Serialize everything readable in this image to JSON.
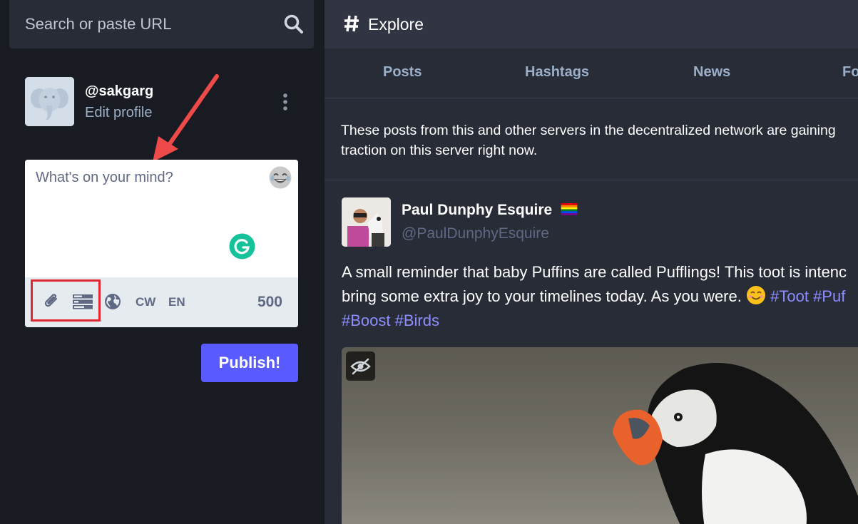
{
  "search": {
    "placeholder": "Search or paste URL",
    "icon": "search-icon"
  },
  "account": {
    "handle": "@sakgarg",
    "edit_label": "Edit profile"
  },
  "compose": {
    "placeholder": "What's on your mind?",
    "cw_label": "CW",
    "language_label": "EN",
    "char_count": "500",
    "publish_label": "Publish!"
  },
  "column": {
    "title": "Explore",
    "tabs": [
      {
        "label": "Posts"
      },
      {
        "label": "Hashtags"
      },
      {
        "label": "News"
      },
      {
        "label": "Fo"
      }
    ],
    "description": "These posts from this and other servers in the decentralized network are gaining traction on this server right now."
  },
  "status": {
    "display_name": "Paul Dunphy Esquire",
    "handle": "@PaulDunphyEsquire",
    "content_text": "A small reminder that baby Puffins are called Pufflings! This toot is intenc bring some extra joy to your timelines today. As you were.",
    "hashtags": [
      "#Toot",
      "#Puf",
      "#Boost",
      "#Birds"
    ]
  },
  "colors": {
    "background": "#191b22",
    "panel": "#282c37",
    "header": "#313543",
    "accent": "#595aff",
    "highlight": "#e3262f",
    "muted": "#9baec8"
  }
}
